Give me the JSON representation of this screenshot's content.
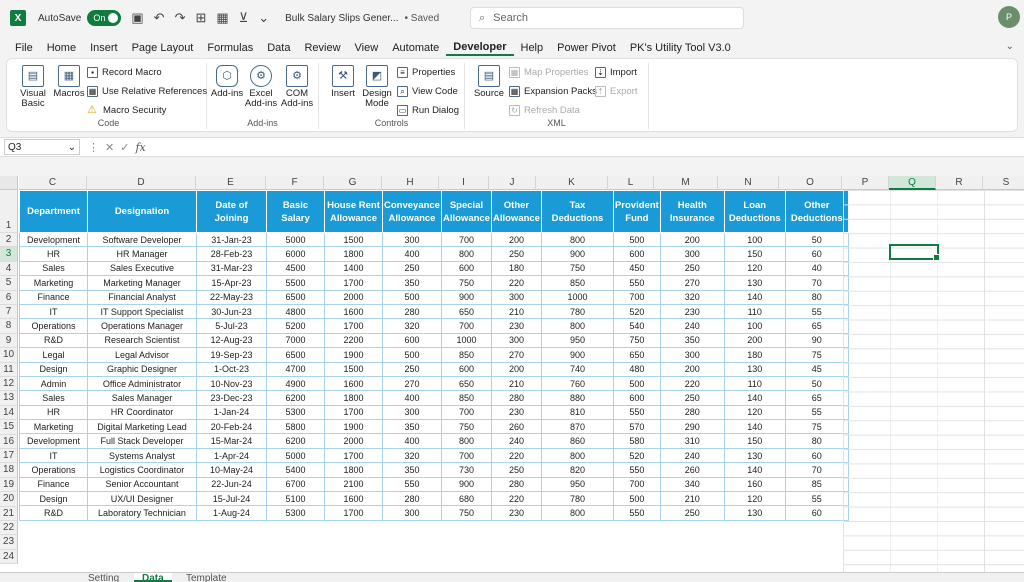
{
  "titlebar": {
    "app_icon": "X",
    "autosave_label": "AutoSave",
    "autosave_state": "On",
    "doc_title": "Bulk Salary Slips Gener...",
    "saved_status": "• Saved",
    "search_placeholder": "Search",
    "avatar_initials": "P"
  },
  "menu": {
    "items": [
      "File",
      "Home",
      "Insert",
      "Page Layout",
      "Formulas",
      "Data",
      "Review",
      "View",
      "Automate",
      "Developer",
      "Help",
      "Power Pivot",
      "PK's Utility Tool V3.0"
    ],
    "active": "Developer"
  },
  "ribbon": {
    "code": {
      "label": "Code",
      "visual_basic": "Visual Basic",
      "macros": "Macros",
      "record_macro": "Record Macro",
      "use_relative": "Use Relative References",
      "macro_security": "Macro Security"
    },
    "addins": {
      "label": "Add-ins",
      "addins": "Add-ins",
      "excel_addins": "Excel Add-ins",
      "com_addins": "COM Add-ins"
    },
    "controls": {
      "label": "Controls",
      "insert": "Insert",
      "design_mode": "Design Mode",
      "properties": "Properties",
      "view_code": "View Code",
      "run_dialog": "Run Dialog"
    },
    "xml": {
      "label": "XML",
      "source": "Source",
      "map_properties": "Map Properties",
      "expansion_packs": "Expansion Packs",
      "refresh_data": "Refresh Data",
      "import": "Import",
      "export": "Export"
    }
  },
  "formula_bar": {
    "name_box": "Q3",
    "fx": "fx"
  },
  "columns": [
    "C",
    "D",
    "E",
    "F",
    "G",
    "H",
    "I",
    "J",
    "K",
    "L",
    "M",
    "N",
    "O",
    "P",
    "Q",
    "R",
    "S"
  ],
  "selected_column": "Q",
  "selected_row": "3",
  "row_numbers": [
    "1",
    "2",
    "3",
    "4",
    "5",
    "6",
    "7",
    "8",
    "9",
    "10",
    "11",
    "12",
    "13",
    "14",
    "15",
    "16",
    "17",
    "18",
    "19",
    "20",
    "21",
    "22",
    "23",
    "24"
  ],
  "table": {
    "headers": [
      "Department",
      "Designation",
      "Date of Joining",
      "Basic Salary",
      "House Rent Allowance",
      "Conveyance Allowance",
      "Special Allowance",
      "Other Allowance",
      "Tax Deductions",
      "Provident Fund",
      "Health Insurance",
      "Loan Deductions",
      "Other Deductions"
    ],
    "rows": [
      [
        "Development",
        "Software Developer",
        "31-Jan-23",
        "5000",
        "1500",
        "300",
        "700",
        "200",
        "800",
        "500",
        "200",
        "100",
        "50"
      ],
      [
        "HR",
        "HR Manager",
        "28-Feb-23",
        "6000",
        "1800",
        "400",
        "800",
        "250",
        "900",
        "600",
        "300",
        "150",
        "60"
      ],
      [
        "Sales",
        "Sales Executive",
        "31-Mar-23",
        "4500",
        "1400",
        "250",
        "600",
        "180",
        "750",
        "450",
        "250",
        "120",
        "40"
      ],
      [
        "Marketing",
        "Marketing Manager",
        "15-Apr-23",
        "5500",
        "1700",
        "350",
        "750",
        "220",
        "850",
        "550",
        "270",
        "130",
        "70"
      ],
      [
        "Finance",
        "Financial Analyst",
        "22-May-23",
        "6500",
        "2000",
        "500",
        "900",
        "300",
        "1000",
        "700",
        "320",
        "140",
        "80"
      ],
      [
        "IT",
        "IT Support Specialist",
        "30-Jun-23",
        "4800",
        "1600",
        "280",
        "650",
        "210",
        "780",
        "520",
        "230",
        "110",
        "55"
      ],
      [
        "Operations",
        "Operations Manager",
        "5-Jul-23",
        "5200",
        "1700",
        "320",
        "700",
        "230",
        "800",
        "540",
        "240",
        "100",
        "65"
      ],
      [
        "R&D",
        "Research Scientist",
        "12-Aug-23",
        "7000",
        "2200",
        "600",
        "1000",
        "300",
        "950",
        "750",
        "350",
        "200",
        "90"
      ],
      [
        "Legal",
        "Legal Advisor",
        "19-Sep-23",
        "6500",
        "1900",
        "500",
        "850",
        "270",
        "900",
        "650",
        "300",
        "180",
        "75"
      ],
      [
        "Design",
        "Graphic Designer",
        "1-Oct-23",
        "4700",
        "1500",
        "250",
        "600",
        "200",
        "740",
        "480",
        "200",
        "130",
        "45"
      ],
      [
        "Admin",
        "Office Administrator",
        "10-Nov-23",
        "4900",
        "1600",
        "270",
        "650",
        "210",
        "760",
        "500",
        "220",
        "110",
        "50"
      ],
      [
        "Sales",
        "Sales Manager",
        "23-Dec-23",
        "6200",
        "1800",
        "400",
        "850",
        "280",
        "880",
        "600",
        "250",
        "140",
        "65"
      ],
      [
        "HR",
        "HR Coordinator",
        "1-Jan-24",
        "5300",
        "1700",
        "300",
        "700",
        "230",
        "810",
        "550",
        "280",
        "120",
        "55"
      ],
      [
        "Marketing",
        "Digital Marketing Lead",
        "20-Feb-24",
        "5800",
        "1900",
        "350",
        "750",
        "260",
        "870",
        "570",
        "290",
        "140",
        "75"
      ],
      [
        "Development",
        "Full Stack Developer",
        "15-Mar-24",
        "6200",
        "2000",
        "400",
        "800",
        "240",
        "860",
        "580",
        "310",
        "150",
        "80"
      ],
      [
        "IT",
        "Systems Analyst",
        "1-Apr-24",
        "5000",
        "1700",
        "320",
        "700",
        "220",
        "800",
        "520",
        "240",
        "130",
        "60"
      ],
      [
        "Operations",
        "Logistics Coordinator",
        "10-May-24",
        "5400",
        "1800",
        "350",
        "730",
        "250",
        "820",
        "550",
        "260",
        "140",
        "70"
      ],
      [
        "Finance",
        "Senior Accountant",
        "22-Jun-24",
        "6700",
        "2100",
        "550",
        "900",
        "280",
        "950",
        "700",
        "340",
        "160",
        "85"
      ],
      [
        "Design",
        "UX/UI Designer",
        "15-Jul-24",
        "5100",
        "1600",
        "280",
        "680",
        "220",
        "780",
        "500",
        "210",
        "120",
        "55"
      ],
      [
        "R&D",
        "Laboratory Technician",
        "1-Aug-24",
        "5300",
        "1700",
        "300",
        "750",
        "230",
        "800",
        "550",
        "250",
        "130",
        "60"
      ]
    ]
  },
  "sheet_tabs": [
    "Setting",
    "Data",
    "Template"
  ],
  "active_sheet": "Data"
}
